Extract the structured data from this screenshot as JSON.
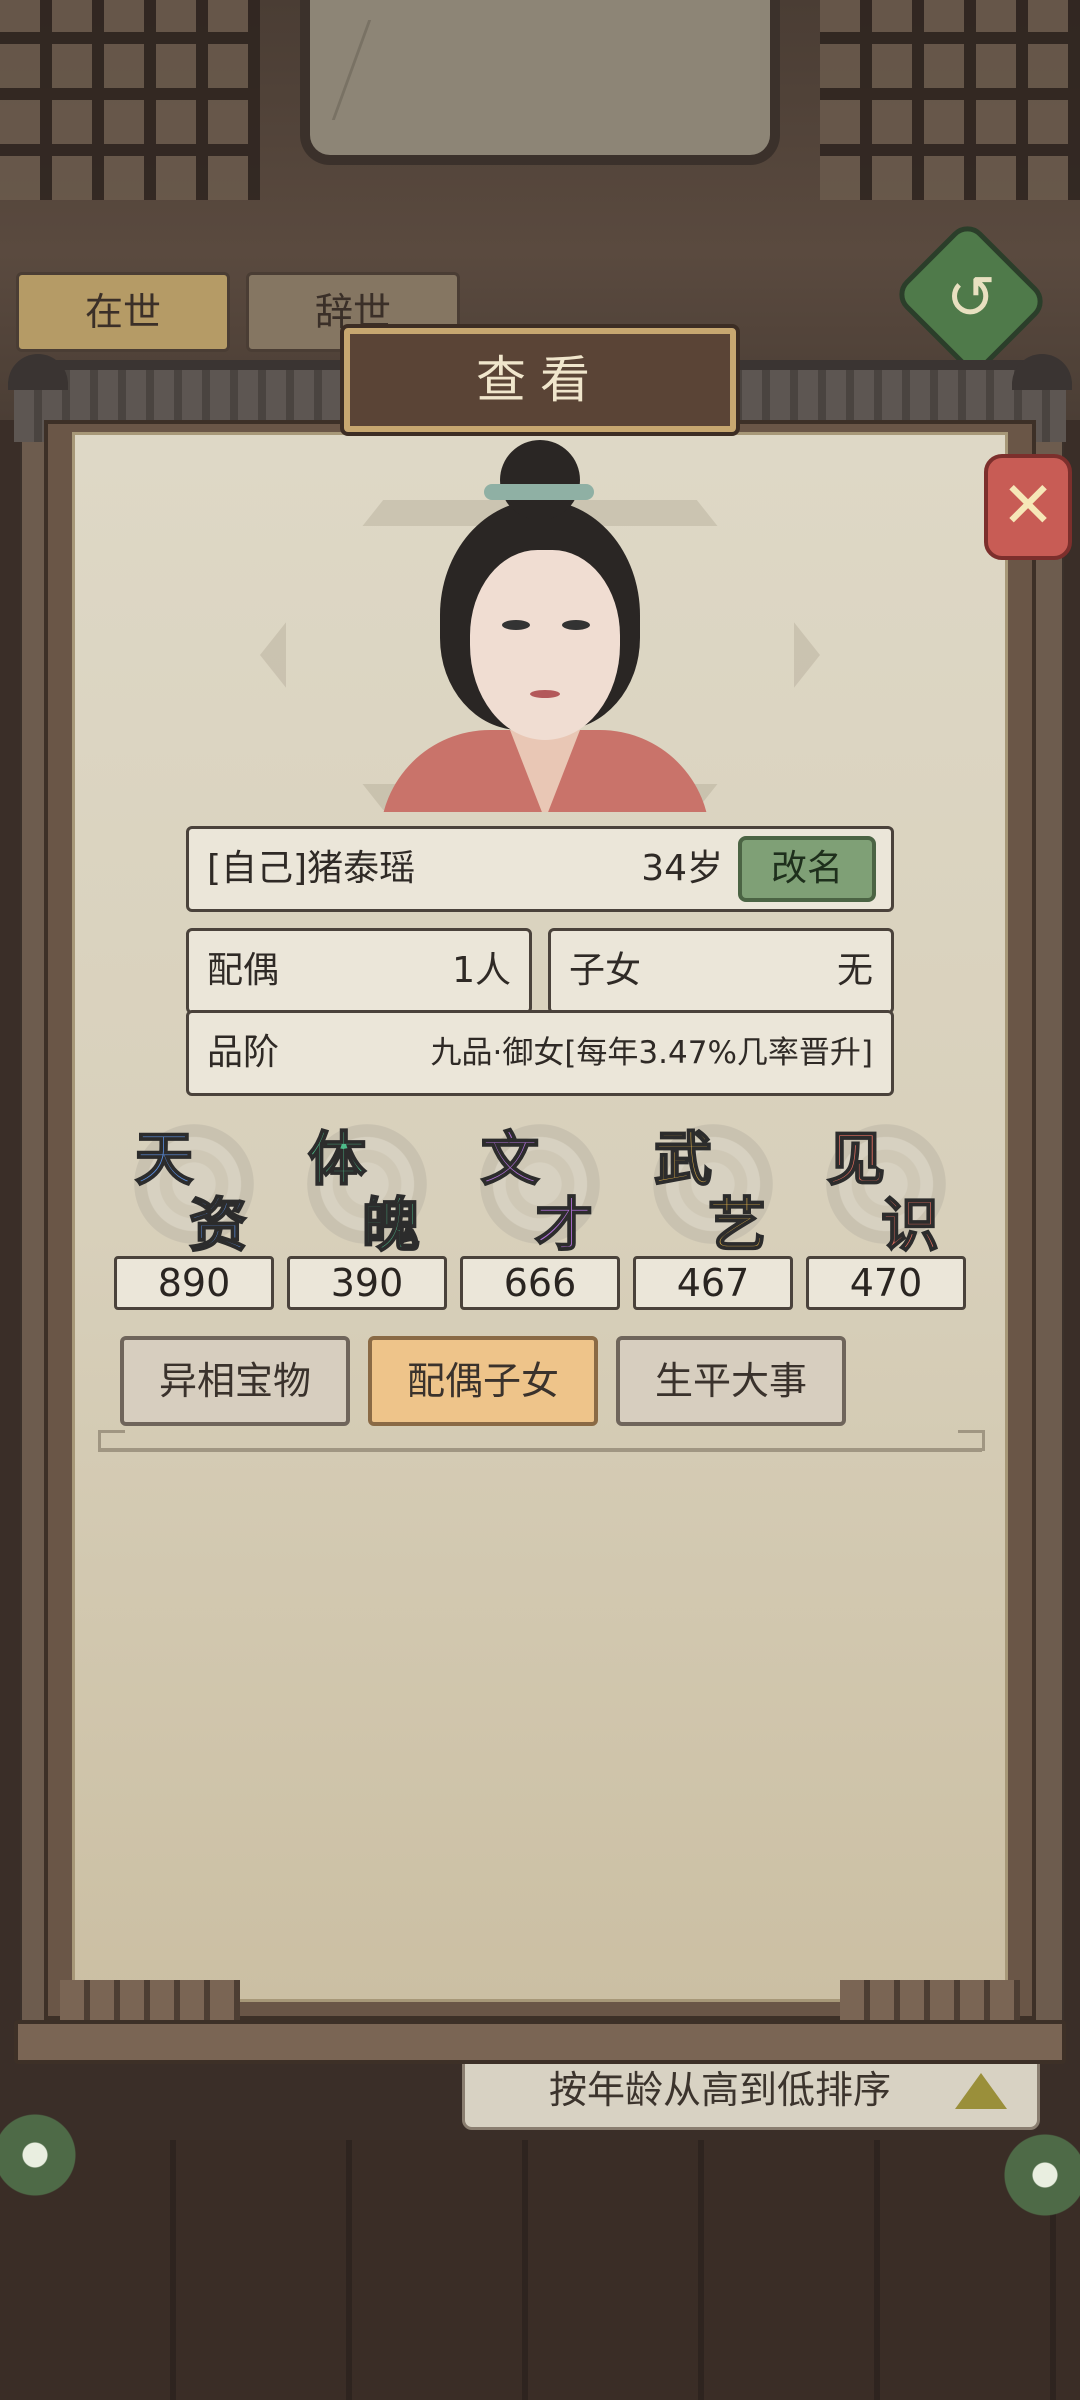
{
  "background": {
    "tabs": [
      {
        "label": "在世",
        "active": true
      },
      {
        "label": "辞世",
        "active": false
      }
    ],
    "sort_label": "按年龄从高到低排序"
  },
  "modal": {
    "title": "查看",
    "close_icon": "close-x-icon"
  },
  "character": {
    "name": "[自己]猪泰瑶",
    "age": "34岁",
    "rename_label": "改名",
    "spouse_label": "配偶",
    "spouse_value": "1人",
    "children_label": "子女",
    "children_value": "无",
    "rank_label": "品阶",
    "rank_value": "九品·御女[每年3.47%几率晋升]"
  },
  "stats": [
    {
      "c1": "天",
      "c2": "资",
      "value": "890",
      "color": "#5b8fe0"
    },
    {
      "c1": "体",
      "c2": "魄",
      "value": "390",
      "color": "#4ebc8a"
    },
    {
      "c1": "文",
      "c2": "才",
      "value": "666",
      "color": "#b070d8"
    },
    {
      "c1": "武",
      "c2": "艺",
      "value": "467",
      "color": "#e2b24a"
    },
    {
      "c1": "见",
      "c2": "识",
      "value": "470",
      "color": "#e66f60"
    }
  ],
  "tabs": [
    {
      "label": "异相宝物",
      "active": false
    },
    {
      "label": "配偶子女",
      "active": true
    },
    {
      "label": "生平大事",
      "active": false
    }
  ]
}
